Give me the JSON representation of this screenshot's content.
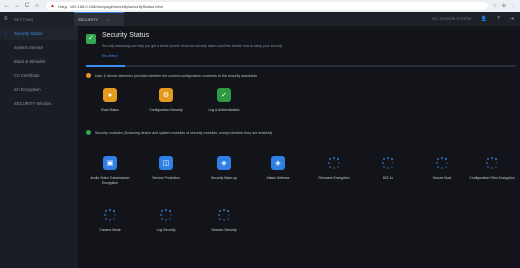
{
  "browser": {
    "back": "←",
    "forward": "→",
    "reload": "C",
    "home": "⌂",
    "warning": "▲",
    "warning_text": "Нэтд",
    "url": "192.168.0.108/doc/page/security/securityStatus.html",
    "tool_icons": [
      "☆",
      "⊕",
      "⋮"
    ]
  },
  "app": {
    "menu_icon": "≡",
    "brand": "SETTING",
    "tab_label": "SECURITY",
    "tab_close": "×",
    "right_text": "SEC-SERVERI-SYSTEM",
    "right_icons": [
      "👤",
      "?",
      "⇥"
    ]
  },
  "sidebar": {
    "items": [
      {
        "label": "Security Status",
        "active": true
      },
      {
        "label": "System Service"
      },
      {
        "label": "Black & Whitelist"
      },
      {
        "label": "CA Certificate"
      },
      {
        "label": "Ich Encryption"
      },
      {
        "label": "SECURITY Window"
      }
    ]
  },
  "main": {
    "title": "Security Status",
    "check": "✓",
    "description": "Security assessing can help you get a whole picture of device security status and then decide how to setup your security",
    "link": "Re-detect",
    "progress": 0.09,
    "section1": "User & device detection provides whether the current configuration conforms to the security standards",
    "section2": "Security modules (Scanning device and system modules of security modules, except whether they are enabled)",
    "group1": [
      {
        "label": "Root Status",
        "icon": "user-icon",
        "color": "orange",
        "glyph": "●"
      },
      {
        "label": "Configuration Security",
        "icon": "gear-icon",
        "color": "orange",
        "glyph": "⚙"
      },
      {
        "label": "Log & Authentication",
        "icon": "shield-icon",
        "color": "green",
        "glyph": "✓"
      }
    ],
    "group2_row1": [
      {
        "label": "Audio Video Transmission Encryption",
        "icon": "video-icon",
        "color": "blue",
        "glyph": "▣",
        "spinner": false
      },
      {
        "label": "Service Protection",
        "icon": "monitor-icon",
        "color": "blue",
        "glyph": "◫",
        "spinner": false
      },
      {
        "label": "Security Warn-up",
        "icon": "shield-icon",
        "color": "blue",
        "glyph": "◈",
        "spinner": false
      },
      {
        "label": "Attack Defense",
        "icon": "shield-icon",
        "color": "blue",
        "glyph": "◈",
        "spinner": false
      },
      {
        "label": "Firmware Encryption",
        "icon": "loading-icon",
        "color": "blue",
        "glyph": "",
        "spinner": true
      },
      {
        "label": "802.1x",
        "icon": "loading-icon",
        "color": "blue",
        "glyph": "",
        "spinner": true
      },
      {
        "label": "Secure Boot",
        "icon": "loading-icon",
        "color": "blue",
        "glyph": "",
        "spinner": true
      },
      {
        "label": "Configuration Files Encryption",
        "icon": "loading-icon",
        "color": "blue",
        "glyph": "",
        "spinner": true
      }
    ],
    "group2_row2": [
      {
        "label": "Camera Mode",
        "icon": "loading-icon",
        "spinner": true
      },
      {
        "label": "Log Security",
        "icon": "loading-icon",
        "spinner": true
      },
      {
        "label": "Session Security",
        "icon": "loading-icon",
        "spinner": true
      }
    ]
  }
}
